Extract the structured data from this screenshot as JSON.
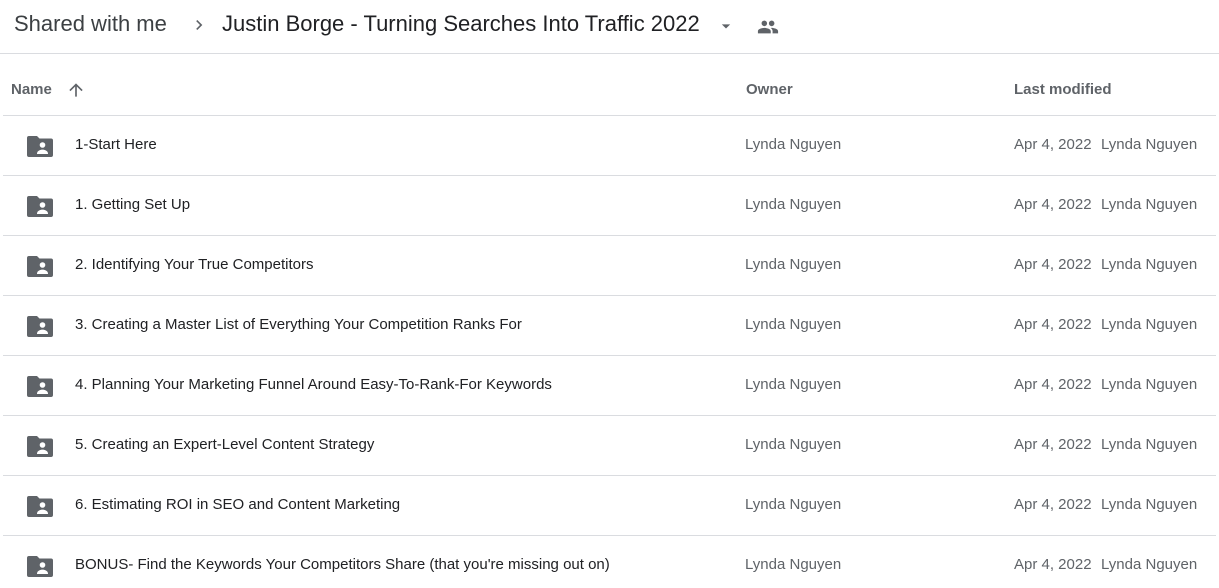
{
  "breadcrumb": {
    "root": "Shared with me",
    "separator_icon": "chevron-right-icon",
    "current": "Justin Borge - Turning Searches Into Traffic 2022",
    "dropdown_icon": "arrow-drop-down-icon",
    "shared_icon": "people-icon"
  },
  "columns": {
    "name": "Name",
    "sort_icon": "arrow-up-icon",
    "owner": "Owner",
    "last_modified": "Last modified"
  },
  "colors": {
    "folder": "#5f6368",
    "divider": "#dadce0",
    "secondary_text": "#5f6368"
  },
  "rows": [
    {
      "name": "1-Start Here",
      "owner": "Lynda Nguyen",
      "date": "Apr 4, 2022",
      "modified_by": "Lynda Nguyen"
    },
    {
      "name": "1. Getting Set Up",
      "owner": "Lynda Nguyen",
      "date": "Apr 4, 2022",
      "modified_by": "Lynda Nguyen"
    },
    {
      "name": "2. Identifying Your True Competitors",
      "owner": "Lynda Nguyen",
      "date": "Apr 4, 2022",
      "modified_by": "Lynda Nguyen"
    },
    {
      "name": "3. Creating a Master List of Everything Your Competition Ranks For",
      "owner": "Lynda Nguyen",
      "date": "Apr 4, 2022",
      "modified_by": "Lynda Nguyen"
    },
    {
      "name": "4. Planning Your Marketing Funnel Around Easy-To-Rank-For Keywords",
      "owner": "Lynda Nguyen",
      "date": "Apr 4, 2022",
      "modified_by": "Lynda Nguyen"
    },
    {
      "name": "5. Creating an Expert-Level Content Strategy",
      "owner": "Lynda Nguyen",
      "date": "Apr 4, 2022",
      "modified_by": "Lynda Nguyen"
    },
    {
      "name": "6. Estimating ROI in SEO and Content Marketing",
      "owner": "Lynda Nguyen",
      "date": "Apr 4, 2022",
      "modified_by": "Lynda Nguyen"
    },
    {
      "name": "BONUS- Find the Keywords Your Competitors Share (that you're missing out on)",
      "owner": "Lynda Nguyen",
      "date": "Apr 4, 2022",
      "modified_by": "Lynda Nguyen"
    }
  ]
}
